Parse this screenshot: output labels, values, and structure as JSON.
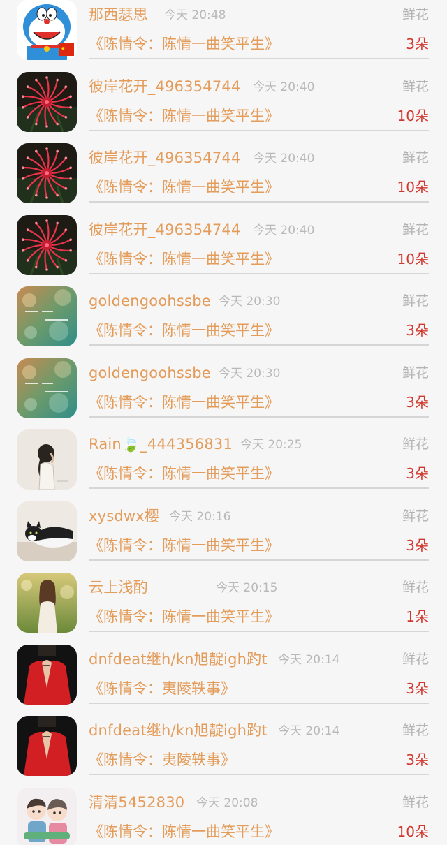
{
  "records": [
    {
      "user": "那西瑟思",
      "time": "今天 20:48",
      "gift_type": "鲜花",
      "book": "《陈情令：陈情一曲笑平生》",
      "count": "3朵",
      "avatar": "doraemon-avatar"
    },
    {
      "user": "彼岸花开_496354744",
      "time": "今天 20:40",
      "gift_type": "鲜花",
      "book": "《陈情令：陈情一曲笑平生》",
      "count": "10朵",
      "avatar": "red-spider-lily-avatar"
    },
    {
      "user": "彼岸花开_496354744",
      "time": "今天 20:40",
      "gift_type": "鲜花",
      "book": "《陈情令：陈情一曲笑平生》",
      "count": "10朵",
      "avatar": "red-spider-lily-avatar"
    },
    {
      "user": "彼岸花开_496354744",
      "time": "今天 20:40",
      "gift_type": "鲜花",
      "book": "《陈情令：陈情一曲笑平生》",
      "count": "10朵",
      "avatar": "red-spider-lily-avatar"
    },
    {
      "user": "goldengoohssbe",
      "time": "今天 20:30",
      "gift_type": "鲜花",
      "book": "《陈情令：陈情一曲笑平生》",
      "count": "3朵",
      "avatar": "bokeh-text-avatar"
    },
    {
      "user": "goldengoohssbe",
      "time": "今天 20:30",
      "gift_type": "鲜花",
      "book": "《陈情令：陈情一曲笑平生》",
      "count": "3朵",
      "avatar": "bokeh-text-avatar"
    },
    {
      "user": "Rain🍃_444356831",
      "time": "今天 20:25",
      "gift_type": "鲜花",
      "book": "《陈情令：陈情一曲笑平生》",
      "count": "3朵",
      "avatar": "girl-sketch-avatar"
    },
    {
      "user": "xysdwx樱",
      "time": "今天 20:16",
      "gift_type": "鲜花",
      "book": "《陈情令：陈情一曲笑平生》",
      "count": "3朵",
      "avatar": "cat-avatar"
    },
    {
      "user": "云上浅酌",
      "time": "今天 20:15",
      "gift_type": "鲜花",
      "book": "《陈情令：陈情一曲笑平生》",
      "count": "1朵",
      "avatar": "girl-back-avatar"
    },
    {
      "user": "dnfdeat继h/kn旭靛igh趵t",
      "time": "今天 20:14",
      "gift_type": "鲜花",
      "book": "《陈情令：夷陵轶事》",
      "count": "3朵",
      "avatar": "red-jacket-avatar"
    },
    {
      "user": "dnfdeat继h/kn旭靛igh趵t",
      "time": "今天 20:14",
      "gift_type": "鲜花",
      "book": "《陈情令：夷陵轶事》",
      "count": "3朵",
      "avatar": "red-jacket-avatar"
    },
    {
      "user": "清清5452830",
      "time": "今天 20:08",
      "gift_type": "鲜花",
      "book": "《陈情令：陈情一曲笑平生》",
      "count": "10朵",
      "avatar": "cartoon-couple-avatar"
    }
  ]
}
